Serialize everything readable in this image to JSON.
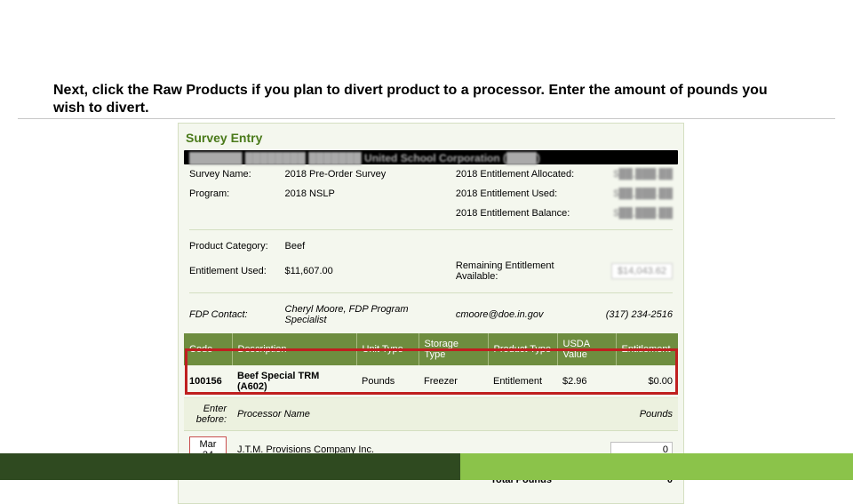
{
  "instruction": "Next, click the Raw Products if you plan to divert product to a processor. Enter the amount of pounds you wish to divert.",
  "panel": {
    "title": "Survey Entry",
    "corp_blur": "███████ ████████ ███████ United School Corporation (████)",
    "labels": {
      "survey_name": "Survey Name:",
      "program": "Program:",
      "ent_allocated": "2018 Entitlement Allocated:",
      "ent_used": "2018 Entitlement Used:",
      "ent_balance": "2018 Entitlement Balance:",
      "prod_cat": "Product Category:",
      "ent_used2": "Entitlement Used:",
      "remaining": "Remaining Entitlement Available:",
      "fdp_contact": "FDP Contact:"
    },
    "values": {
      "survey_name": "2018 Pre-Order Survey",
      "program": "2018 NSLP",
      "prod_cat": "Beef",
      "ent_used2": "$11,607.00",
      "remaining_blur": "$14,043.62",
      "ent_allocated_blur": "$██,███.██",
      "ent_used_blur": "$██,███.██",
      "ent_balance_blur": "$██,███.██"
    },
    "fdp": {
      "name": "Cheryl Moore, FDP Program Specialist",
      "email": "cmoore@doe.in.gov",
      "phone": "(317) 234-2516"
    }
  },
  "columns": {
    "code": "Code",
    "description": "Description",
    "unit_type": "Unit Type",
    "storage_type": "Storage Type",
    "product_type": "Product Type",
    "usda_value": "USDA Value",
    "entitlement": "Entitlement"
  },
  "product": {
    "code": "100156",
    "desc": "Beef Special TRM (A602)",
    "unit": "Pounds",
    "storage": "Freezer",
    "ptype": "Entitlement",
    "usda": "$2.96",
    "ent": "$0.00"
  },
  "sub": {
    "enter_before": "Enter before:",
    "processor_name": "Processor Name",
    "pounds": "Pounds",
    "date": "Mar 24",
    "processor": "J.T.M. Provisions Company Inc.",
    "pounds_value": "0",
    "total_label": "Total Pounds",
    "total_value": "0"
  }
}
